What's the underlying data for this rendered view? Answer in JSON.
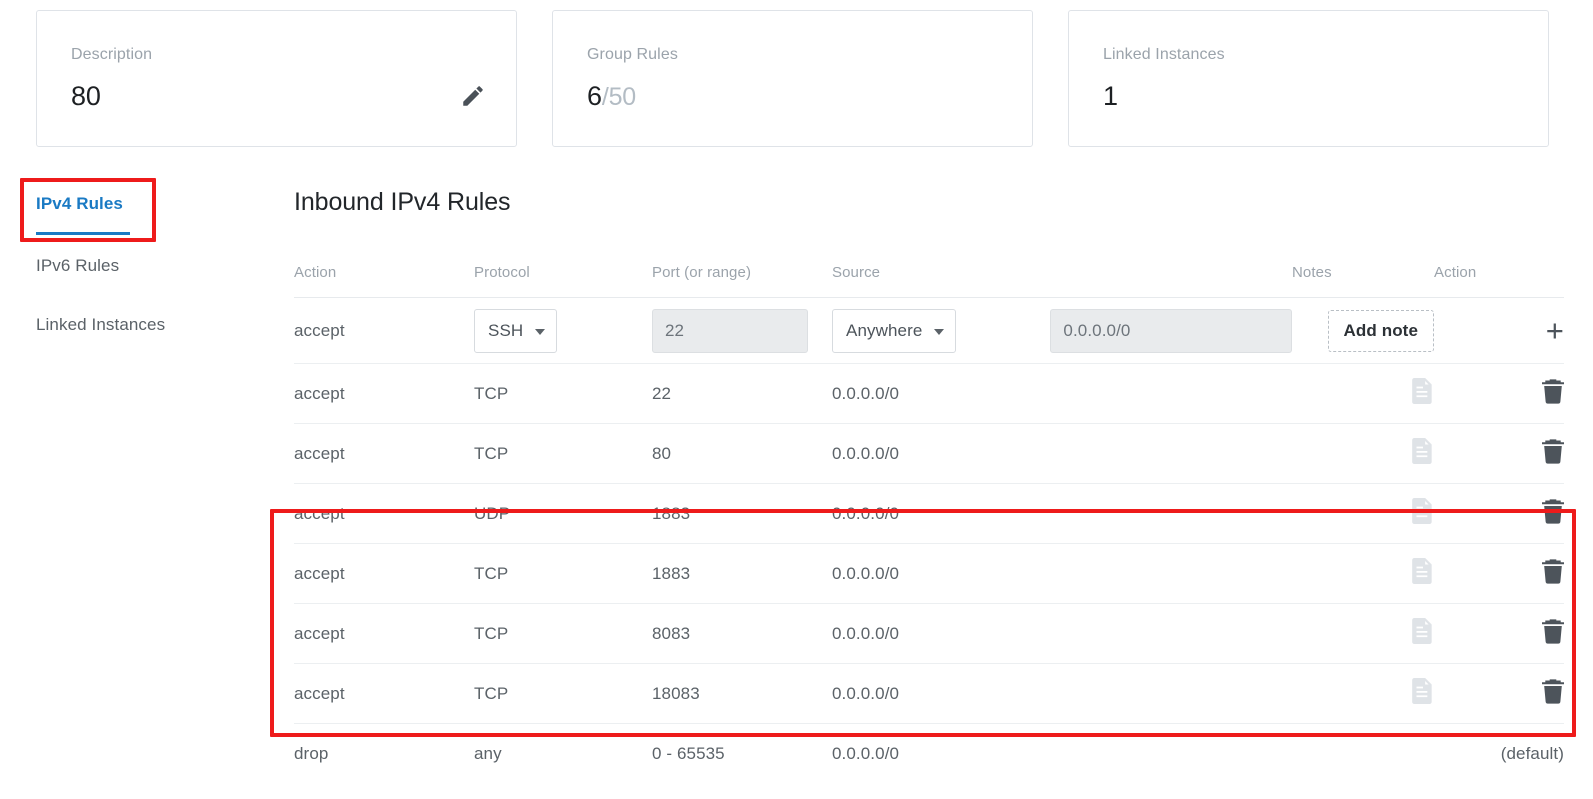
{
  "cards": [
    {
      "label": "Description",
      "value": "80",
      "value_muted": "",
      "has_edit": true,
      "icon": "pencil-icon"
    },
    {
      "label": "Group Rules",
      "value": "6",
      "value_muted": "/50",
      "has_edit": false
    },
    {
      "label": "Linked Instances",
      "value": "1",
      "value_muted": "",
      "has_edit": false
    }
  ],
  "side_tabs": [
    {
      "label": "IPv4 Rules",
      "active": true
    },
    {
      "label": "IPv6 Rules",
      "active": false
    },
    {
      "label": "Linked Instances",
      "active": false
    }
  ],
  "main": {
    "title": "Inbound IPv4 Rules",
    "columns": {
      "action": "Action",
      "protocol": "Protocol",
      "port": "Port (or range)",
      "source": "Source",
      "notes": "Notes",
      "action2": "Action"
    },
    "input_row": {
      "action": "accept",
      "protocol_select": "SSH",
      "port_value": "22",
      "source_select": "Anywhere",
      "source_value": "0.0.0.0/0",
      "add_note_label": "Add note",
      "add_icon": "plus-icon"
    },
    "rows": [
      {
        "action": "accept",
        "protocol": "TCP",
        "port": "22",
        "source": "0.0.0.0/0",
        "notes_icon": "note-icon",
        "action_icon": "trash-icon",
        "highlighted": false
      },
      {
        "action": "accept",
        "protocol": "TCP",
        "port": "80",
        "source": "0.0.0.0/0",
        "notes_icon": "note-icon",
        "action_icon": "trash-icon",
        "highlighted": false
      },
      {
        "action": "accept",
        "protocol": "UDP",
        "port": "1883",
        "source": "0.0.0.0/0",
        "notes_icon": "note-icon",
        "action_icon": "trash-icon",
        "highlighted": true
      },
      {
        "action": "accept",
        "protocol": "TCP",
        "port": "1883",
        "source": "0.0.0.0/0",
        "notes_icon": "note-icon",
        "action_icon": "trash-icon",
        "highlighted": true
      },
      {
        "action": "accept",
        "protocol": "TCP",
        "port": "8083",
        "source": "0.0.0.0/0",
        "notes_icon": "note-icon",
        "action_icon": "trash-icon",
        "highlighted": true
      },
      {
        "action": "accept",
        "protocol": "TCP",
        "port": "18083",
        "source": "0.0.0.0/0",
        "notes_icon": "note-icon",
        "action_icon": "trash-icon",
        "highlighted": true
      },
      {
        "action": "drop",
        "protocol": "any",
        "port": "0 - 65535",
        "source": "0.0.0.0/0",
        "notes_icon": "",
        "action_text": "(default)",
        "highlighted": false
      }
    ]
  },
  "colors": {
    "accent_blue": "#1a7ac4",
    "annotation_red": "#ee1b1b",
    "text_primary": "#22262a",
    "text_secondary": "#5b6268",
    "text_muted": "#9ba3ab",
    "border": "#e7eaed",
    "input_disabled_bg": "#e9ebed"
  }
}
